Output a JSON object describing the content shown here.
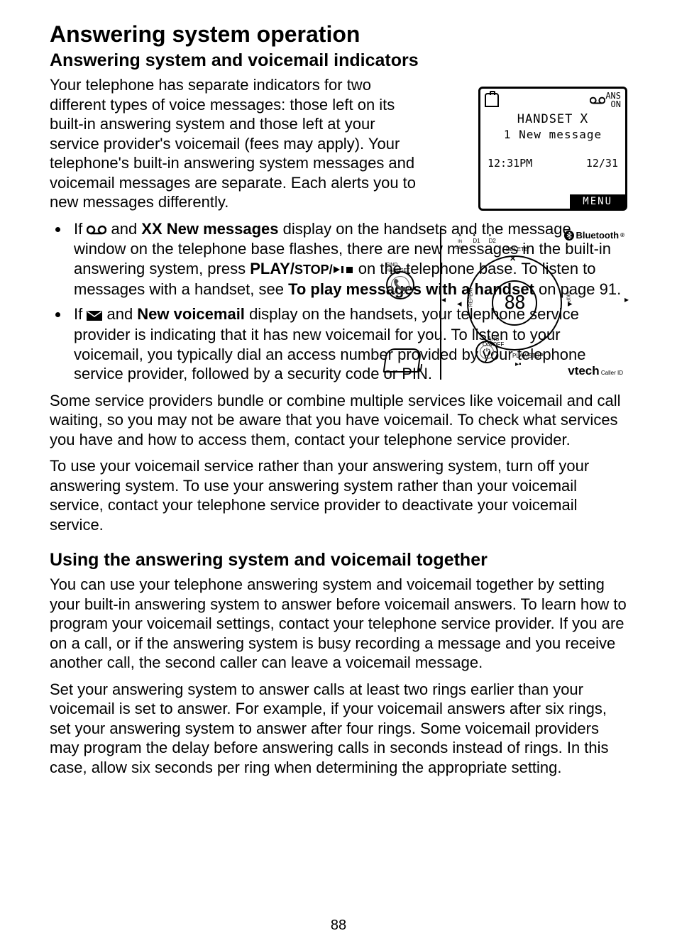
{
  "title": "Answering system operation",
  "subtitle1": "Answering system and voicemail indicators",
  "intro": "Your telephone has separate indicators for two different types of voice messages: those left on its built-in answering system and those left at your service provider's voicemail (fees may apply). Your telephone's built-in answering system messages and voicemail messages are separate. Each alerts you to new messages differently.",
  "bullet1": {
    "lead": "If ",
    "afterTape": " and ",
    "bold1": "XX New messages",
    "mid": " display on the handsets and the message window on the telephone base flashes, there are new messages in the built-in answering system, press ",
    "bold2": "PLAY/",
    "bold2sc": "STOP/",
    "afterSym": " on the telephone base. To listen to messages with a handset, see ",
    "bold3": "To play messages with a handset",
    "tail": " on page 91."
  },
  "bullet2": {
    "lead": "If ",
    "afterEnv": " and ",
    "bold1": "New voicemail",
    "tail": " display on the handsets, your telephone service provider is indicating that it has new voicemail for you. To listen to your voicemail, you typically dial an access number provided by your telephone service provider, followed by a security code or PIN."
  },
  "para2": "Some service providers bundle or combine multiple services like voicemail and call waiting, so you may not be aware that you have voicemail. To check what services you have and how to access them, contact your telephone service provider.",
  "para3": "To use your voicemail service rather than your answering system, turn off your answering system. To use your answering system rather than your voicemail service, contact your telephone service provider to deactivate your voicemail service.",
  "subtitle2": "Using the answering system and voicemail together",
  "para4": "You can use your telephone answering system and voicemail together by setting your built-in answering system to answer before voicemail answers. To learn how to program your voicemail settings, contact your telephone service provider. If you are on a call, or if the answering system is busy recording a message and you receive another call, the second caller can leave a voicemail message.",
  "para5": "Set your answering system to answer calls at least two rings earlier than your voicemail is set to answer. For example, if your voicemail answers after six rings, set your answering system to answer after four rings. Some voicemail providers may program the delay before answering calls in seconds instead of rings. In this case, allow six seconds per ring when determining the appropriate setting.",
  "pageNumber": "88",
  "handset": {
    "ansLine1": "ANS",
    "ansLine2": "ON",
    "line1_label": "HANDSET",
    "line1_x": "X",
    "line2": "1 New message",
    "time": "12:31PM",
    "date": "12/31",
    "menu": "MENU"
  },
  "base": {
    "findHandset": "FIND\nHANDSET",
    "inUse": "IN\nUSE",
    "d1": "D1",
    "d2": "D2",
    "bluetooth": "Bluetooth",
    "delete": "DELETE",
    "count": "88",
    "repeat": "REPEAT",
    "skip": "SKIP",
    "ansOnOff": "ANS\nON/OFF",
    "playStop": "PLAY/STOP",
    "brand": "vtech",
    "brandTag": " Caller ID"
  }
}
